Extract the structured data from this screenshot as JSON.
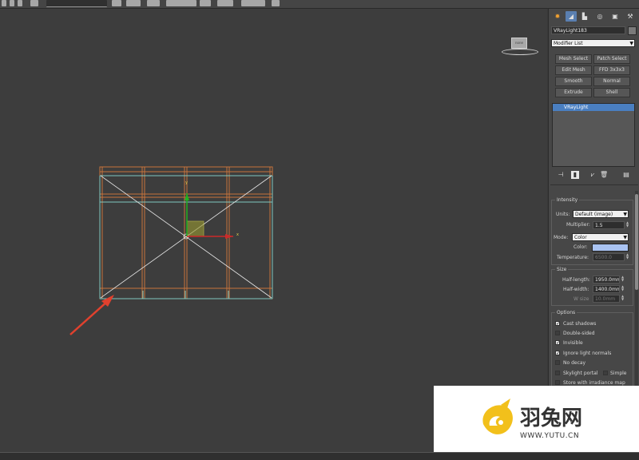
{
  "viewport": {
    "viewcube_label": "none",
    "axis_x_label": "x",
    "axis_y_label": "y"
  },
  "panel": {
    "object_name": "VRayLight183",
    "modifier_list_label": "Modifier List",
    "modifier_buttons": [
      "Mesh Select",
      "Patch Select",
      "Edit Mesh",
      "FFD 3x3x3",
      "Smooth",
      "Normal",
      "Extrude",
      "Shell"
    ],
    "stack_item": "VRayLight",
    "intensity": {
      "title": "Intensity",
      "units_label": "Units:",
      "units_value": "Default (image)",
      "multiplier_label": "Multiplier:",
      "multiplier_value": "1.5",
      "mode_label": "Mode:",
      "mode_value": "Color",
      "color_label": "Color:",
      "color_value": "#a9c3f2",
      "temperature_label": "Temperature:",
      "temperature_value": "6500.0"
    },
    "size": {
      "title": "Size",
      "half_length_label": "Half-length:",
      "half_length_value": "1950.0mm",
      "half_width_label": "Half-width:",
      "half_width_value": "1400.0mm",
      "w_size_label": "W size",
      "w_size_value": "10.0mm"
    },
    "options": {
      "title": "Options",
      "items": [
        {
          "label": "Cast shadows",
          "checked": true
        },
        {
          "label": "Double-sided",
          "checked": false
        },
        {
          "label": "Invisible",
          "checked": true
        },
        {
          "label": "Ignore light normals",
          "checked": true
        },
        {
          "label": "No decay",
          "checked": false
        },
        {
          "label": "Skylight portal",
          "checked": false
        },
        {
          "label": "Store with irradiance map",
          "checked": false
        }
      ],
      "simple_label": "Simple"
    }
  },
  "watermark": {
    "name_cn": "羽兔网",
    "url": "WWW.YUTU.CN"
  },
  "colors": {
    "frame_orange": "#c8743c",
    "frame_cyan": "#7fc7c0",
    "light_diagonals": "#e8e8e8",
    "arrow_red": "#e0412e",
    "selection_blue": "#4a7fc1",
    "logo_yellow": "#f2c01b"
  }
}
